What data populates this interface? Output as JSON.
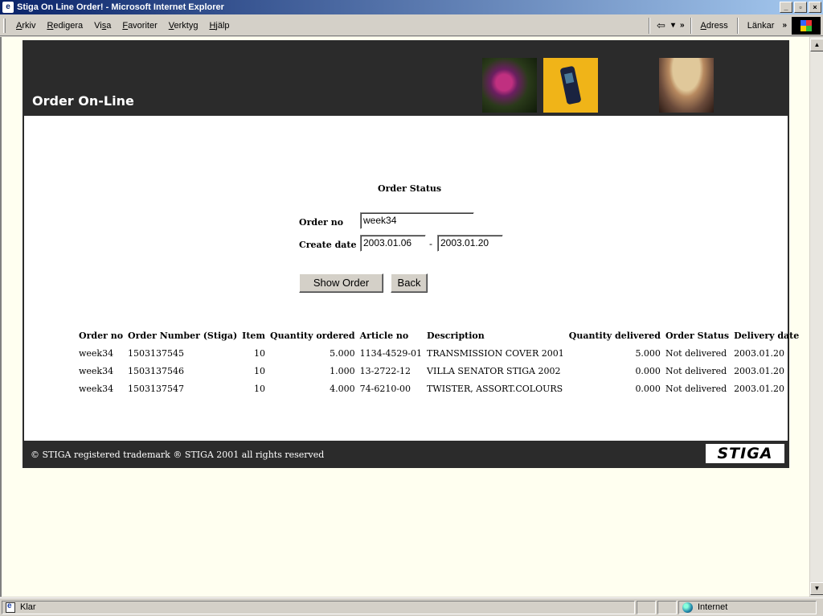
{
  "window": {
    "title": "Stiga On Line Order! - Microsoft Internet Explorer",
    "buttons": [
      "_",
      "▫",
      "×"
    ]
  },
  "menubar": {
    "items": [
      {
        "pre": "",
        "key": "A",
        "post": "rkiv"
      },
      {
        "pre": "",
        "key": "R",
        "post": "edigera"
      },
      {
        "pre": "Vi",
        "key": "s",
        "post": "a"
      },
      {
        "pre": "",
        "key": "F",
        "post": "avoriter"
      },
      {
        "pre": "",
        "key": "V",
        "post": "erktyg"
      },
      {
        "pre": "",
        "key": "H",
        "post": "jälp"
      }
    ],
    "back_glyph": "⇦",
    "dropdown_glyph": "▾",
    "chevron": "»",
    "address_label_key": "A",
    "address_label_rest": "dress",
    "links_label": "Länkar"
  },
  "stray_text": "e",
  "header": {
    "title": "Order On-Line"
  },
  "form": {
    "section_title": "Order Status",
    "order_no_label": "Order no",
    "order_no_value": "week34",
    "create_date_label": "Create date",
    "date_from": "2003.01.06",
    "date_sep": "-",
    "date_to": "2003.01.20",
    "show_order_label": "Show Order",
    "back_label": "Back"
  },
  "table": {
    "headers": [
      "Order no",
      "Order Number (Stiga)",
      "Item",
      "Quantity ordered",
      "Article no",
      "Description",
      "Quantity delivered",
      "Order Status",
      "Delivery date"
    ],
    "rows": [
      [
        "week34",
        "1503137545",
        "10",
        "5.000",
        "1134-4529-01",
        "TRANSMISSION COVER 2001",
        "5.000",
        "Not delivered",
        "2003.01.20"
      ],
      [
        "week34",
        "1503137546",
        "10",
        "1.000",
        "13-2722-12",
        "VILLA SENATOR STIGA 2002",
        "0.000",
        "Not delivered",
        "2003.01.20"
      ],
      [
        "week34",
        "1503137547",
        "10",
        "4.000",
        "74-6210-00",
        "TWISTER, ASSORT.COLOURS",
        "0.000",
        "Not delivered",
        "2003.01.20"
      ]
    ]
  },
  "footer": {
    "text": "© STIGA registered trademark  ® STIGA 2001 all rights reserved",
    "logo_text": "STIGA"
  },
  "statusbar": {
    "status": "Klar",
    "zone": "Internet"
  },
  "colors": {
    "header_bg": "#2b2b2b",
    "page_bg": "#fffff0",
    "titlebar_start": "#0a246a"
  }
}
